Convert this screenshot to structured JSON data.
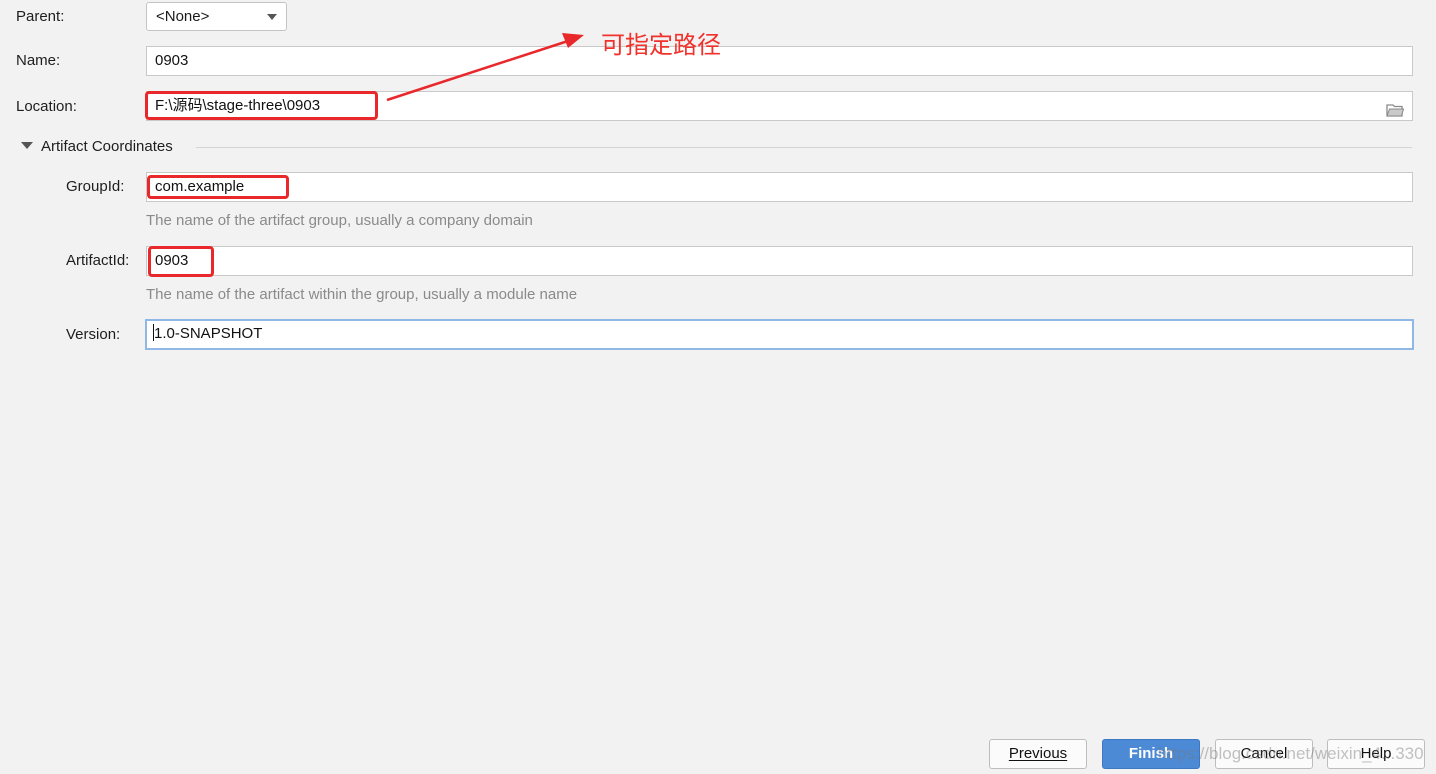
{
  "form": {
    "parent": {
      "label": "Parent:",
      "value": "<None>"
    },
    "name": {
      "label": "Name:",
      "value": "0903"
    },
    "location": {
      "label": "Location:",
      "value": "F:\\源码\\stage-three\\0903"
    }
  },
  "artifact": {
    "section_title": "Artifact Coordinates",
    "group_id": {
      "label": "GroupId:",
      "value": "com.example",
      "hint": "The name of the artifact group, usually a company domain"
    },
    "artifact_id": {
      "label": "ArtifactId:",
      "value": "0903",
      "hint": "The name of the artifact within the group, usually a module name"
    },
    "version": {
      "label": "Version:",
      "value": "1.0-SNAPSHOT"
    }
  },
  "annotation": {
    "text": "可指定路径",
    "color": "#f1312b"
  },
  "buttons": {
    "previous": "Previous",
    "finish": "Finish",
    "cancel": "Cancel",
    "help": "Help"
  },
  "watermark": "https://blog.csdn.net/weixin_4...330",
  "colors": {
    "accent": "#4c8ad6",
    "highlight": "#e8282b",
    "focus_border": "#8fb8e6"
  }
}
